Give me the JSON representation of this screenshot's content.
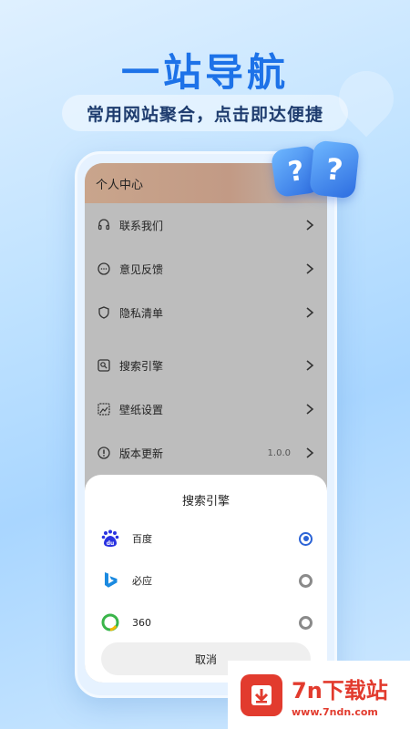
{
  "hero": {
    "title": "一站导航",
    "subtitle": "常用网站聚合，点击即达便捷"
  },
  "screen": {
    "header_title": "个人中心",
    "menu": [
      {
        "label": "联系我们",
        "icon": "headset-icon"
      },
      {
        "label": "意见反馈",
        "icon": "chat-bubble-icon"
      },
      {
        "label": "隐私清单",
        "icon": "shield-icon"
      },
      {
        "label": "搜索引擎",
        "icon": "search-engine-icon"
      },
      {
        "label": "壁纸设置",
        "icon": "wallpaper-icon"
      },
      {
        "label": "版本更新",
        "icon": "info-icon",
        "value": "1.0.0"
      }
    ]
  },
  "sheet": {
    "title": "搜索引擎",
    "options": [
      {
        "label": "百度",
        "icon": "baidu-logo-icon",
        "selected": true
      },
      {
        "label": "必应",
        "icon": "bing-logo-icon",
        "selected": false
      },
      {
        "label": "360",
        "icon": "360-logo-icon",
        "selected": false
      }
    ],
    "cancel_label": "取消"
  },
  "bubbles": [
    "?",
    "?"
  ],
  "watermark": {
    "title": "7n下载站",
    "url": "www.7ndn.com"
  },
  "colors": {
    "accent": "#1d72e8",
    "radio_selected": "#2b63d6",
    "watermark_red": "#e23b2e"
  }
}
